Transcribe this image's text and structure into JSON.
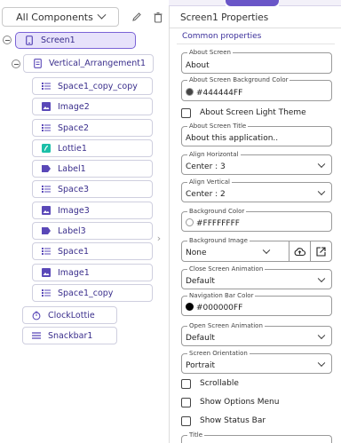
{
  "header": {
    "components_dropdown": "All Components"
  },
  "tree": {
    "screen": "Screen1",
    "arrangement": "Vertical_Arrangement1",
    "children": [
      "Space1_copy_copy",
      "Image2",
      "Space2",
      "Lottie1",
      "Label1",
      "Space3",
      "Image3",
      "Label3",
      "Space1",
      "Image1",
      "Space1_copy"
    ],
    "nonvisible": [
      "ClockLottie",
      "Snackbar1"
    ]
  },
  "properties": {
    "title": "Screen1 Properties",
    "section": "Common properties",
    "about_screen": {
      "label": "About Screen",
      "value": "About"
    },
    "bg_color": {
      "label": "About Screen Background Color",
      "value": "#444444FF",
      "swatch": "#444444"
    },
    "light_theme": {
      "label": "About Screen Light Theme",
      "checked": false
    },
    "about_title": {
      "label": "About Screen Title",
      "value": "About this application.."
    },
    "align_h": {
      "label": "Align Horizontal",
      "value": "Center : 3"
    },
    "align_v": {
      "label": "Align Vertical",
      "value": "Center : 2"
    },
    "background_color": {
      "label": "Background Color",
      "value": "#FFFFFFFF",
      "swatch": "#FFFFFF"
    },
    "background_image": {
      "label": "Background Image",
      "value": "None"
    },
    "close_anim": {
      "label": "Close Screen Animation",
      "value": "Default"
    },
    "navbar_color": {
      "label": "Navigation Bar Color",
      "value": "#000000FF",
      "swatch": "#000000"
    },
    "open_anim": {
      "label": "Open Screen Animation",
      "value": "Default"
    },
    "orientation": {
      "label": "Screen Orientation",
      "value": "Portrait"
    },
    "scrollable": {
      "label": "Scrollable",
      "checked": false
    },
    "options_menu": {
      "label": "Show Options Menu",
      "checked": false
    },
    "status_bar": {
      "label": "Show Status Bar",
      "checked": false
    },
    "title_field": {
      "label": "Title"
    }
  },
  "colors": {
    "accent": "#6a56c8",
    "selected_bg": "#e7e2fb",
    "tree_text": "#3a2e8c",
    "lottie_icon": "#1bbfa8"
  }
}
